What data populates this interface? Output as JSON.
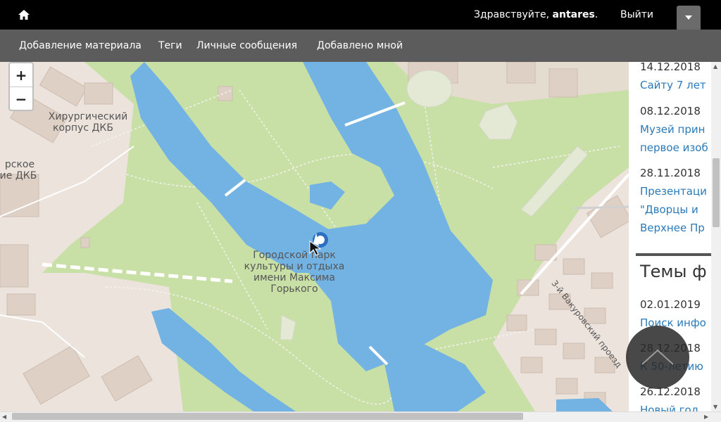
{
  "header": {
    "greeting_prefix": "Здравствуйте, ",
    "username": "antares",
    "greeting_suffix": ".",
    "logout_label": "Выйти"
  },
  "nav": {
    "items": [
      "Добавление материала",
      "Теги",
      "Личные сообщения",
      "Добавлено мной"
    ]
  },
  "map": {
    "labels": {
      "hospital_1_line1": "Хирургический",
      "hospital_1_line2": "корпус ДКБ",
      "hospital_2_line1": "рское",
      "hospital_2_line2": "ие ДКБ",
      "park_line1": "Городской парк",
      "park_line2": "культуры и отдыха",
      "park_line3": "имени Максима",
      "park_line4": "Горького",
      "street": "3-й Вакуровский проезд"
    },
    "zoom_in": "+",
    "zoom_out": "−"
  },
  "sidebar": {
    "news": [
      {
        "date": "14.12.2018",
        "title_lines": [
          "Сайту 7 лет"
        ]
      },
      {
        "date": "08.12.2018",
        "title_lines": [
          "Музей прин",
          "первое изоб"
        ]
      },
      {
        "date": "28.11.2018",
        "title_lines": [
          "Презентаци",
          "\"Дворцы и",
          "Верхнее Пр"
        ]
      }
    ],
    "section_heading": "Темы ф",
    "topics": [
      {
        "date": "02.01.2019",
        "title": "Поиск инфо"
      },
      {
        "date": "28.12.2018",
        "title": "К 50-летию"
      },
      {
        "date": "26.12.2018",
        "title": "Новый год"
      }
    ]
  },
  "colors": {
    "park": "#c8dfa6",
    "water": "#73b3e3",
    "urban": "#ece3dd",
    "building": "#dfd0c6",
    "link": "#2a7ab8"
  }
}
